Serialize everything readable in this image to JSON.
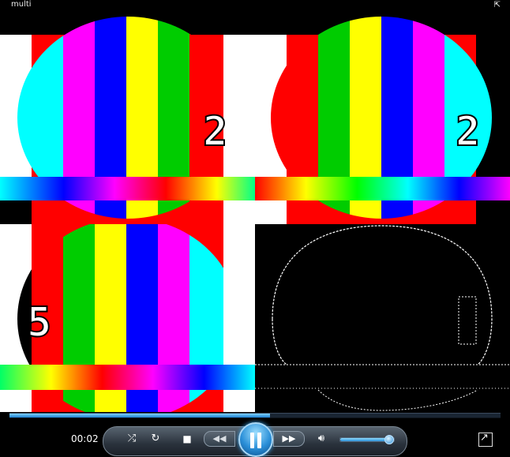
{
  "window": {
    "title": "multi"
  },
  "tiles": [
    {
      "digit": "2"
    },
    {
      "digit": "2"
    },
    {
      "digit": "5"
    }
  ],
  "player": {
    "elapsed": "00:02",
    "seek_progress": 0.53,
    "volume": 0.9,
    "icons": {
      "shuffle": "shuffle-icon",
      "repeat": "repeat-icon",
      "stop": "stop-icon",
      "previous": "previous-icon",
      "play_pause": "pause-icon",
      "next": "next-icon",
      "volume": "speaker-icon",
      "fullscreen": "fullscreen-icon",
      "switch_to_library": "switch-to-library-icon"
    }
  }
}
